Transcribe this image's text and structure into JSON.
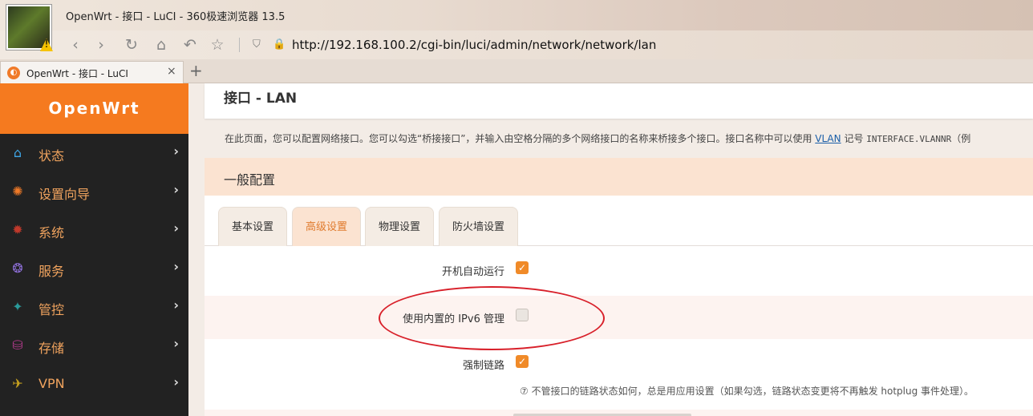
{
  "browser": {
    "window_title": "OpenWrt - 接口 - LuCI - 360极速浏览器 13.5",
    "url": "http://192.168.100.2/cgi-bin/luci/admin/network/network/lan",
    "tab_title": "OpenWrt - 接口 - LuCI",
    "tab_close": "×",
    "new_tab": "+",
    "nav": {
      "back": "‹",
      "forward": "›",
      "refresh": "↻",
      "home": "⌂",
      "undo": "↶",
      "favorite": "☆"
    },
    "shield_glyph": "⛉",
    "lock_glyph": "🔒",
    "warning_glyph": "!"
  },
  "sidebar": {
    "brand": "OpenWrt",
    "arrow": "›",
    "items": [
      {
        "label": "状态",
        "icon": "home-icon",
        "glyph": "⌂",
        "color": "#3fa7e8"
      },
      {
        "label": "设置向导",
        "icon": "wizard-icon",
        "glyph": "✺",
        "color": "#f07a28"
      },
      {
        "label": "系统",
        "icon": "gear-icon",
        "glyph": "✹",
        "color": "#c0392b"
      },
      {
        "label": "服务",
        "icon": "services-icon",
        "glyph": "❂",
        "color": "#8e6fd8"
      },
      {
        "label": "管控",
        "icon": "control-icon",
        "glyph": "✦",
        "color": "#2a9a9a"
      },
      {
        "label": "存储",
        "icon": "storage-icon",
        "glyph": "⛁",
        "color": "#b03a8a"
      },
      {
        "label": "VPN",
        "icon": "vpn-icon",
        "glyph": "✈",
        "color": "#c8a21e"
      }
    ]
  },
  "page": {
    "title": "接口 - LAN",
    "description_prefix": "在此页面，您可以配置网络接口。您可以勾选“桥接接口”，并输入由空格分隔的多个网络接口的名称来桥接多个接口。接口名称中可以使用 ",
    "description_link": "VLAN",
    "description_mid": " 记号 ",
    "description_code": "INTERFACE.VLANNR",
    "description_suffix": "（例"
  },
  "section": {
    "title": "一般配置",
    "tabs": [
      "基本设置",
      "高级设置",
      "物理设置",
      "防火墙设置"
    ],
    "active_tab": 1,
    "fields": [
      {
        "label": "开机自动运行",
        "checked": true
      },
      {
        "label": "使用内置的 IPv6 管理",
        "checked": false
      },
      {
        "label": "强制链路",
        "checked": true
      }
    ],
    "check_glyph": "✓",
    "hint": "⑦ 不管接口的链路状态如何，总是用应用设置（如果勾选，链路状态变更将不再触发 hotplug 事件处理）。"
  },
  "colors": {
    "accent": "#f57a1f",
    "sidebar_bg": "#222222",
    "sidebar_text": "#f0a35e",
    "section_head": "#fbe3d1",
    "annotation": "#d8202a"
  }
}
